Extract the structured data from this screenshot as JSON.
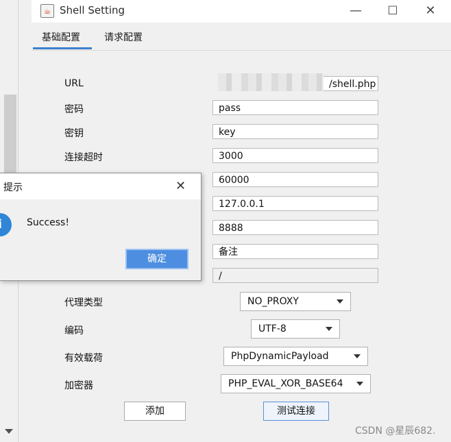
{
  "window": {
    "title": "Shell Setting",
    "minimize": "—",
    "maximize": "☐",
    "close": "✕",
    "icon": "java-cup-icon"
  },
  "tabs": [
    {
      "label": "基础配置",
      "active": true
    },
    {
      "label": "请求配置",
      "active": false
    }
  ],
  "form": {
    "url_label": "URL",
    "url_value": "/shell.php",
    "password_label": "密码",
    "password_value": "pass",
    "key_label": "密钥",
    "key_value": "key",
    "timeout_label": "连接超时",
    "timeout_value": "3000",
    "read_timeout_value": "60000",
    "proxy_host_value": "127.0.0.1",
    "proxy_port_value": "8888",
    "remark_value": "备注",
    "path_value": "/",
    "proxy_type_label": "代理类型",
    "proxy_type_value": "NO_PROXY",
    "encoding_label": "编码",
    "encoding_value": "UTF-8",
    "payload_label": "有效载荷",
    "payload_value": "PhpDynamicPayload",
    "crypto_label": "加密器",
    "crypto_value": "PHP_EVAL_XOR_BASE64"
  },
  "buttons": {
    "add": "添加",
    "test": "测试连接"
  },
  "dialog": {
    "title": "提示",
    "close": "✕",
    "message": "Success!",
    "ok": "确定",
    "icon": "info-icon"
  },
  "watermark": "CSDN @星辰682.",
  "colors": {
    "accent": "#3c7fd0",
    "ok_button": "#4d8ee0",
    "info_icon": "#2f86d6"
  }
}
